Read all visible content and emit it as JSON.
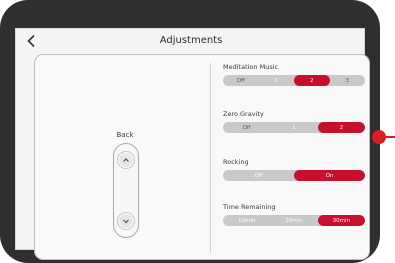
{
  "screen": {
    "title": "Adjustments"
  },
  "left": {
    "label": "Back"
  },
  "groups": [
    {
      "label": "Meditation Music",
      "options": [
        "Off",
        "1",
        "2",
        "3"
      ],
      "selected": 2
    },
    {
      "label": "Zero Gravity",
      "options": [
        "Off",
        "1",
        "2"
      ],
      "selected": 2
    },
    {
      "label": "Rocking",
      "options": [
        "Off",
        "On"
      ],
      "selected": 1
    },
    {
      "label": "Time Remaining",
      "options": [
        "10min",
        "20min",
        "30min"
      ],
      "selected": 2
    }
  ],
  "colors": {
    "accent": "#c8102e",
    "segment_bg": "#c9c9c9",
    "bezel": "#2f2f2f",
    "indicator": "#d81f26"
  },
  "icons": [
    "back-arrow-icon",
    "chevron-up-icon",
    "chevron-down-icon"
  ]
}
